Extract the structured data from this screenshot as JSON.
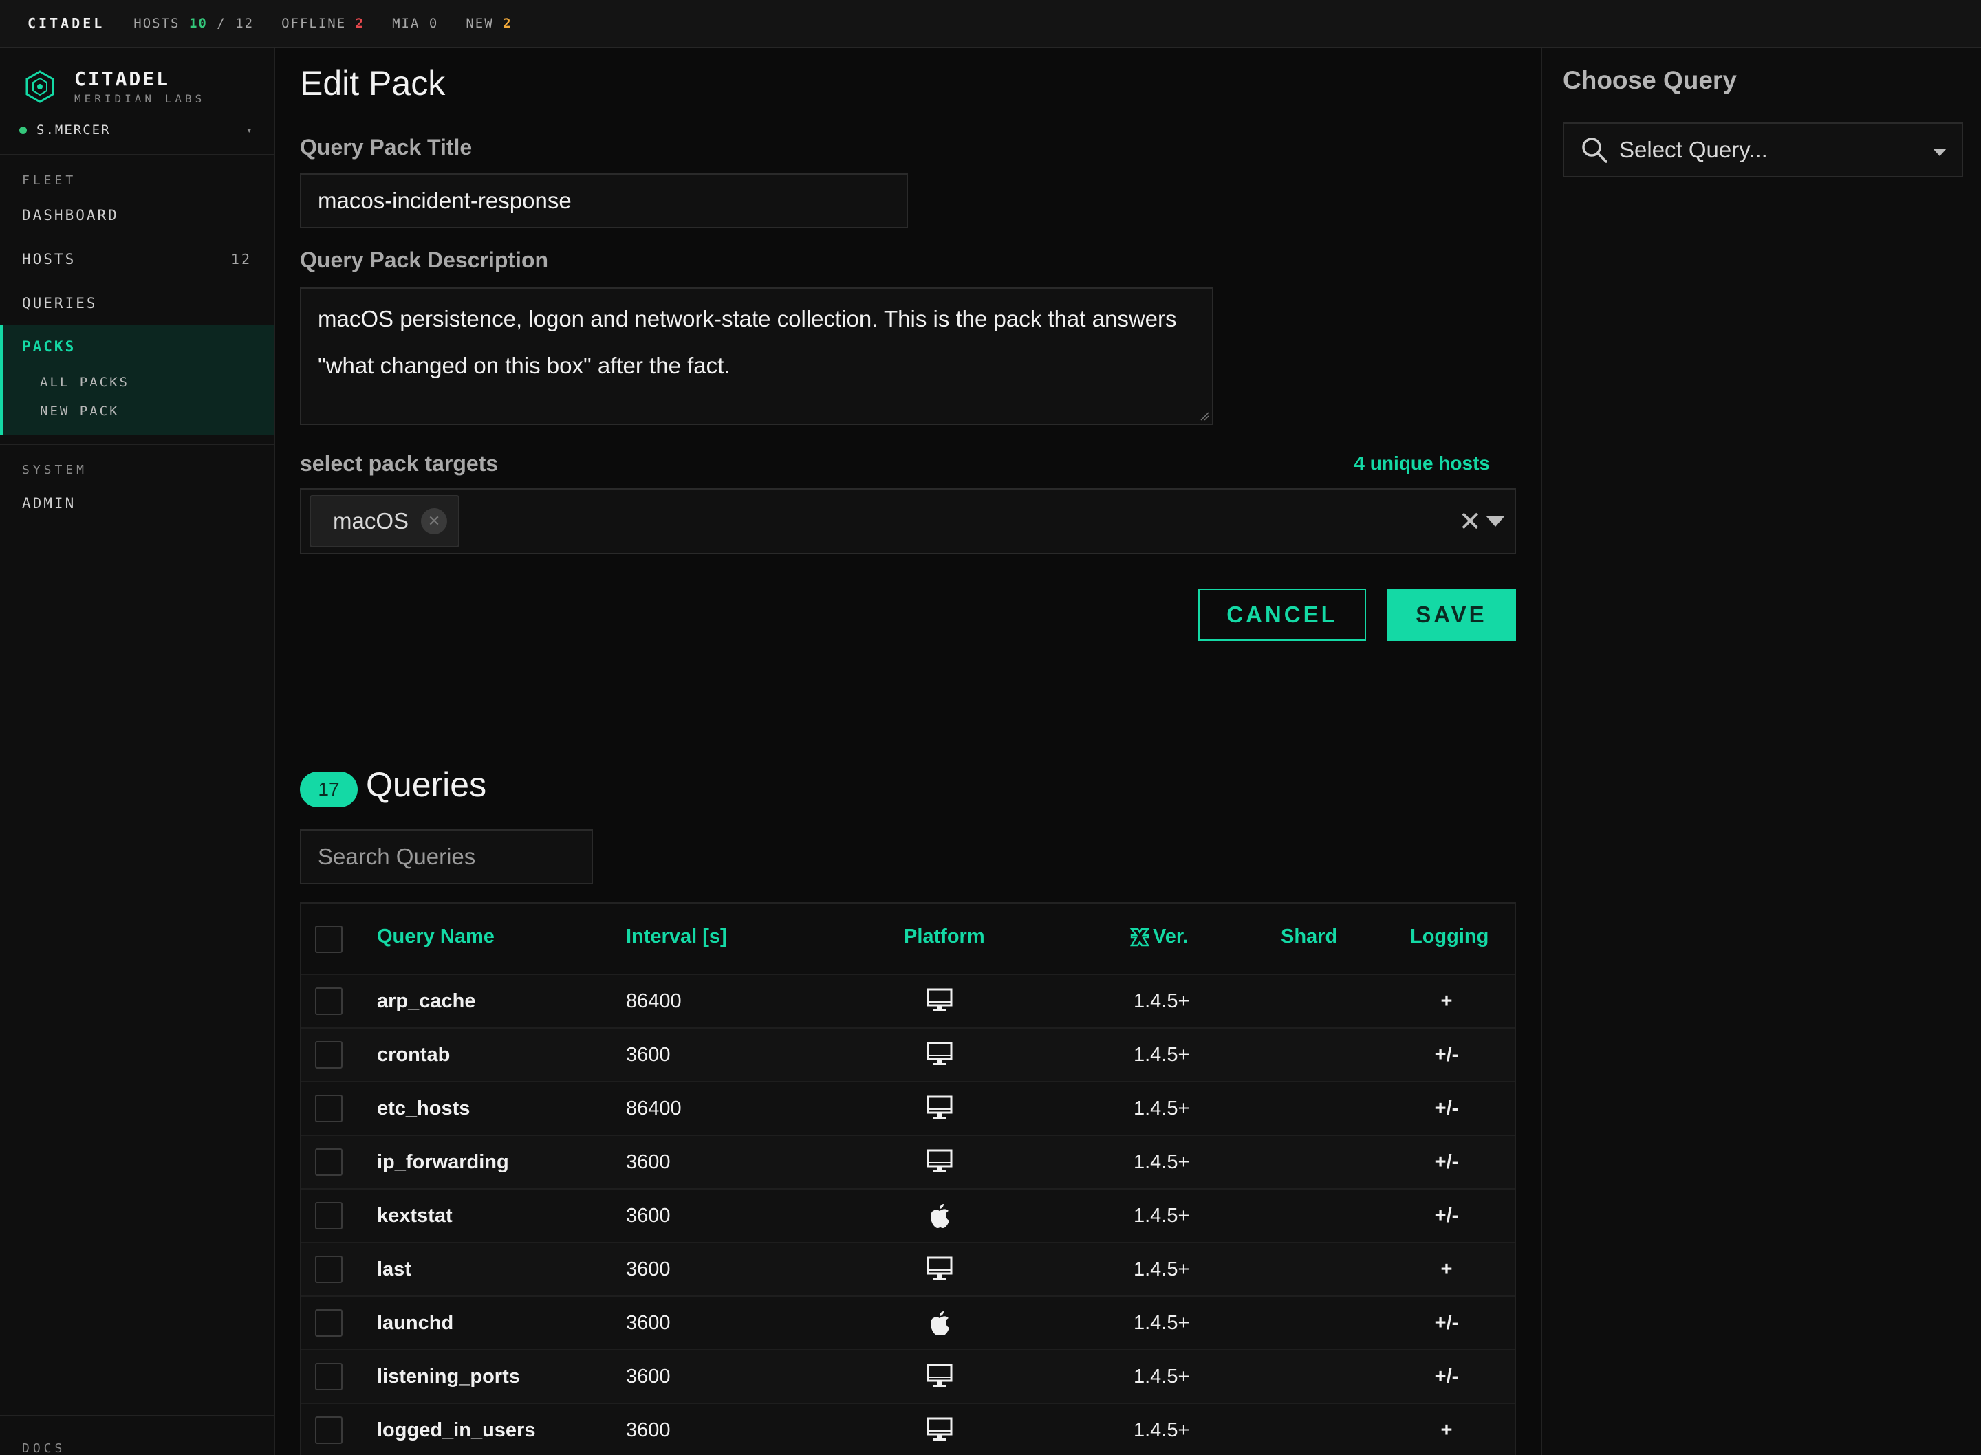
{
  "topbar": {
    "brand": "CITADEL",
    "hosts_label": "HOSTS",
    "hosts_online": "10",
    "hosts_sep": "/",
    "hosts_total": "12",
    "offline_label": "OFFLINE",
    "offline_count": "2",
    "mia_label": "MIA",
    "mia_count": "0",
    "new_label": "NEW",
    "new_count": "2"
  },
  "sidebar": {
    "app_name": "CITADEL",
    "org": "MERIDIAN LABS",
    "user": "S.MERCER",
    "fleet_section": "FLEET",
    "items": [
      {
        "label": "DASHBOARD"
      },
      {
        "label": "HOSTS",
        "count": "12"
      },
      {
        "label": "QUERIES"
      }
    ],
    "packs": {
      "label": "PACKS",
      "children": [
        {
          "label": "ALL PACKS"
        },
        {
          "label": "NEW PACK"
        }
      ]
    },
    "system_section": "SYSTEM",
    "admin": "ADMIN",
    "docs": "DOCS"
  },
  "form": {
    "page_title": "Edit Pack",
    "title_label": "Query Pack Title",
    "title_value": "macos-incident-response",
    "desc_label": "Query Pack Description",
    "desc_value": "macOS persistence, logon and network-state collection. This is the pack that answers \"what changed on this box\" after the fact.",
    "targets_label": "select pack targets",
    "unique_hosts": "4 unique hosts",
    "target_chip": "macOS",
    "cancel": "CANCEL",
    "save": "SAVE"
  },
  "queries": {
    "count": "17",
    "title": "Queries",
    "search_placeholder": "Search Queries",
    "columns": {
      "name": "Query Name",
      "interval": "Interval [s]",
      "platform": "Platform",
      "version": "Ver.",
      "shard": "Shard",
      "logging": "Logging"
    },
    "rows": [
      {
        "name": "arp_cache",
        "interval": "86400",
        "platform": "desktop-icon",
        "version": "1.4.5+",
        "shard": "",
        "logging": "+"
      },
      {
        "name": "crontab",
        "interval": "3600",
        "platform": "desktop-icon",
        "version": "1.4.5+",
        "shard": "",
        "logging": "+/-"
      },
      {
        "name": "etc_hosts",
        "interval": "86400",
        "platform": "desktop-icon",
        "version": "1.4.5+",
        "shard": "",
        "logging": "+/-"
      },
      {
        "name": "ip_forwarding",
        "interval": "3600",
        "platform": "desktop-icon",
        "version": "1.4.5+",
        "shard": "",
        "logging": "+/-"
      },
      {
        "name": "kextstat",
        "interval": "3600",
        "platform": "apple-icon",
        "version": "1.4.5+",
        "shard": "",
        "logging": "+/-"
      },
      {
        "name": "last",
        "interval": "3600",
        "platform": "desktop-icon",
        "version": "1.4.5+",
        "shard": "",
        "logging": "+"
      },
      {
        "name": "launchd",
        "interval": "3600",
        "platform": "apple-icon",
        "version": "1.4.5+",
        "shard": "",
        "logging": "+/-"
      },
      {
        "name": "listening_ports",
        "interval": "3600",
        "platform": "desktop-icon",
        "version": "1.4.5+",
        "shard": "",
        "logging": "+/-"
      },
      {
        "name": "logged_in_users",
        "interval": "3600",
        "platform": "desktop-icon",
        "version": "1.4.5+",
        "shard": "",
        "logging": "+"
      }
    ]
  },
  "right_panel": {
    "title": "Choose Query",
    "select_placeholder": "Select Query..."
  },
  "colors": {
    "accent": "#14d9a5",
    "online": "#34c77b",
    "offline": "#e5484d",
    "new": "#f0a83a"
  }
}
